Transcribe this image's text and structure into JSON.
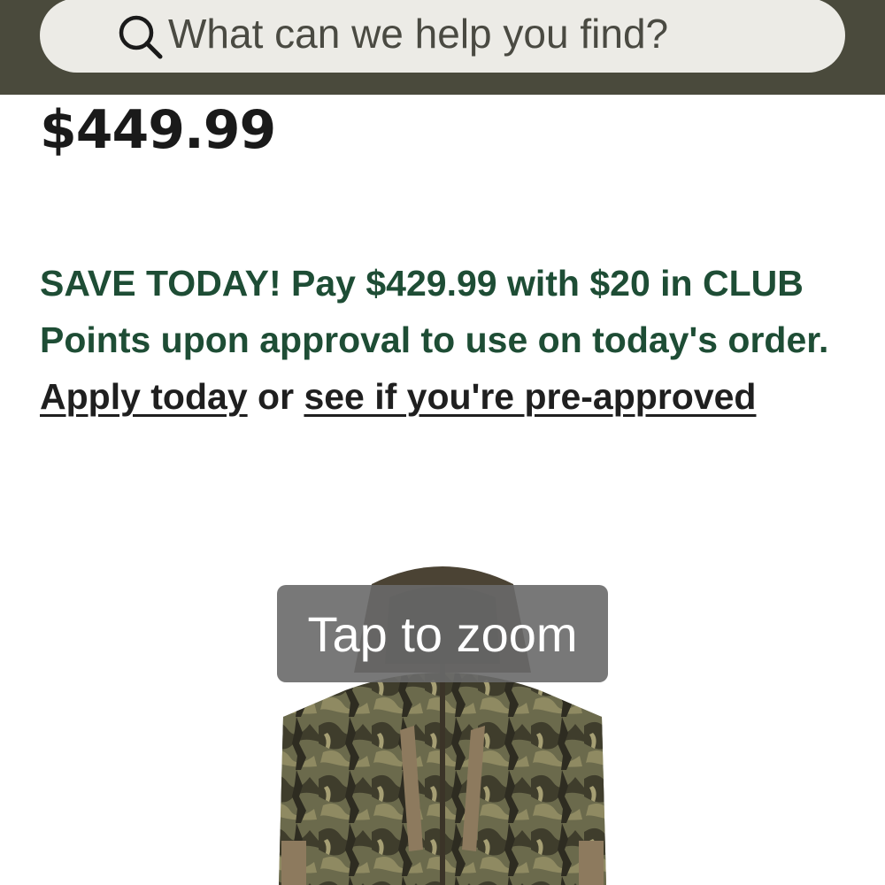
{
  "header": {
    "search": {
      "placeholder": "What can we help you find?",
      "icon": "search-icon"
    },
    "background_color": "#4a4a3c"
  },
  "product": {
    "price": "$449.99",
    "promo": {
      "text_before": "SAVE TODAY! Pay $429.99 with $20 in CLUB Points upon approval to use on today's order.",
      "apply_link": "Apply today",
      "connector": "or",
      "preapproved_link": "see if you're pre-approved",
      "color": "#1e4d35"
    },
    "image": {
      "alt": "camouflage jacket",
      "zoom_hint": "Tap to zoom"
    }
  }
}
